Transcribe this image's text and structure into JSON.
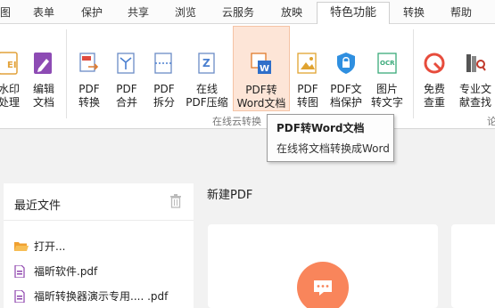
{
  "menu": {
    "tabs": [
      {
        "label": "图"
      },
      {
        "label": "表单"
      },
      {
        "label": "保护"
      },
      {
        "label": "共享"
      },
      {
        "label": "浏览"
      },
      {
        "label": "云服务"
      },
      {
        "label": "放映"
      },
      {
        "label": "特色功能"
      },
      {
        "label": "转换"
      },
      {
        "label": "帮助"
      }
    ]
  },
  "ribbon": {
    "buttons": [
      {
        "label": "水印\n处理"
      },
      {
        "label": "编辑\n文档"
      },
      {
        "label": "PDF\n转换"
      },
      {
        "label": "PDF\n合并"
      },
      {
        "label": "PDF\n拆分"
      },
      {
        "label": "在线\nPDF压缩"
      },
      {
        "label": "PDF转\nWord文档"
      },
      {
        "label": "PDF\n转图"
      },
      {
        "label": "PDF文\n档保护"
      },
      {
        "label": "图片\n转文字"
      },
      {
        "label": "免费\n查重"
      },
      {
        "label": "专业文\n献查找"
      }
    ],
    "groups": {
      "online_convert": "在线云转换",
      "last": "论"
    }
  },
  "tooltip": {
    "title": "PDF转Word文档",
    "description": "在线将文档转换成Word"
  },
  "recent": {
    "title": "最近文件",
    "open_label": "打开...",
    "files": [
      {
        "name": "福昕软件.pdf"
      },
      {
        "name": "福昕转换器演示专用.... .pdf"
      }
    ]
  },
  "newpdf": {
    "title": "新建PDF"
  },
  "colors": {
    "accent": "#f9855b",
    "highlight": "#fde5d7",
    "pdf_icon": "#8e44ad",
    "folder": "#f0a030"
  }
}
